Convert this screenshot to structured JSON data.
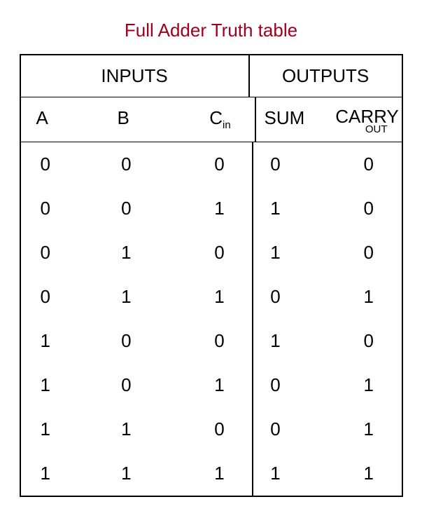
{
  "title": "Full Adder Truth table",
  "groups": {
    "inputs": "INPUTS",
    "outputs": "OUTPUTS"
  },
  "cols": {
    "a": "A",
    "b": "B",
    "cin_main": "C",
    "cin_sub": "in",
    "sum": "SUM",
    "carry_main": "CARRY",
    "carry_sub": "OUT"
  },
  "chart_data": {
    "type": "table",
    "title": "Full Adder Truth table",
    "columns": [
      "A",
      "B",
      "Cin",
      "SUM",
      "CARRY_OUT"
    ],
    "rows": [
      [
        0,
        0,
        0,
        0,
        0
      ],
      [
        0,
        0,
        1,
        1,
        0
      ],
      [
        0,
        1,
        0,
        1,
        0
      ],
      [
        0,
        1,
        1,
        0,
        1
      ],
      [
        1,
        0,
        0,
        1,
        0
      ],
      [
        1,
        0,
        1,
        0,
        1
      ],
      [
        1,
        1,
        0,
        0,
        1
      ],
      [
        1,
        1,
        1,
        1,
        1
      ]
    ]
  }
}
